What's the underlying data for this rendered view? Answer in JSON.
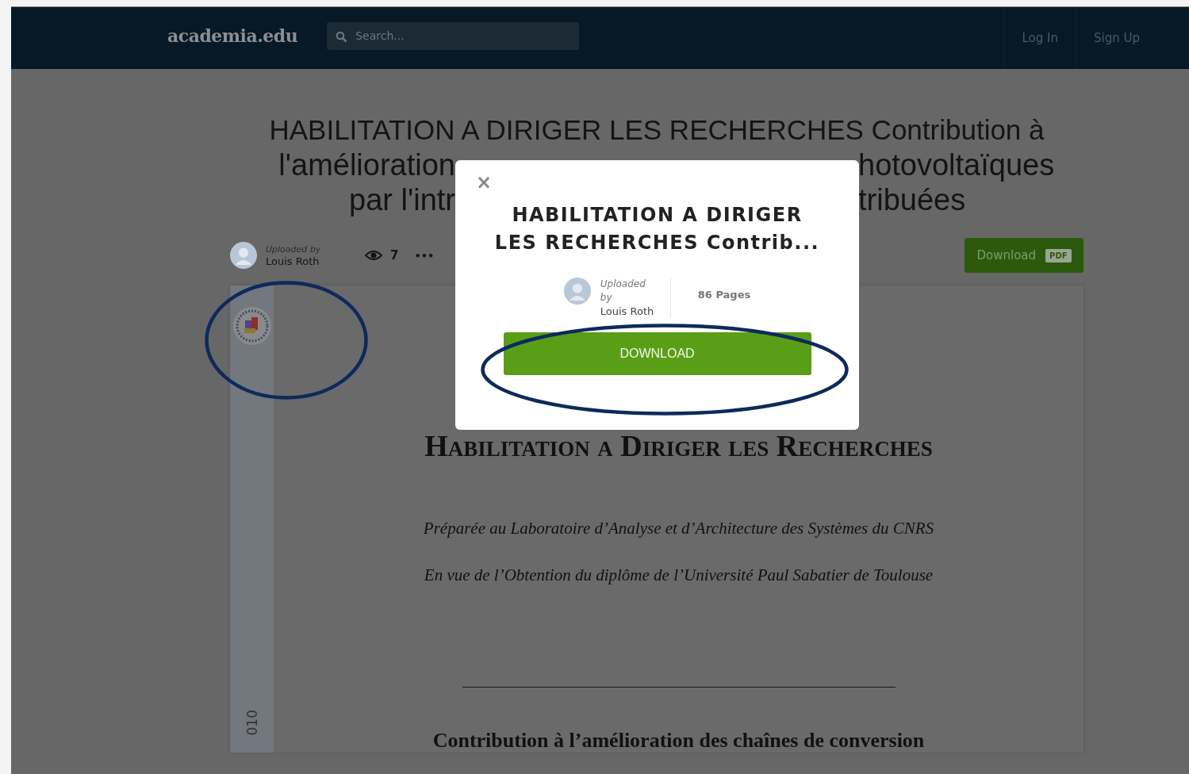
{
  "header": {
    "logo": "academia.edu",
    "search": {
      "placeholder": "Search..."
    },
    "nav": [
      {
        "label": "Log In"
      },
      {
        "label": "Sign Up"
      }
    ]
  },
  "document": {
    "title_lines": [
      {
        "left": "HABILITATION A DIRIGER LES RECHERCHES Contribution à"
      },
      {
        "left": "l'amélioration",
        "right": "hotovoltaïques"
      },
      {
        "left": "par l'intr",
        "right": "tribuées"
      }
    ],
    "uploader_label": "Uploaded by",
    "uploader": "Louis Roth",
    "views": "7",
    "more": "•••",
    "download_label": "Download",
    "download_badge": "PDF",
    "page": {
      "side_text": "010",
      "heading": "Habilitation a Diriger les Recherches",
      "lines": [
        "Préparée au Laboratoire d’Analyse et d’Architecture des Systèmes du CNRS",
        "En vue de l’Obtention du diplôme de l’Université Paul Sabatier de Toulouse"
      ],
      "subtitle": "Contribution à l’amélioration des chaînes de conversion"
    }
  },
  "modal": {
    "close": "×",
    "title_lines": [
      "HABILITATION A DIRIGER",
      "LES RECHERCHES Contrib..."
    ],
    "uploader_label": "Uploaded by",
    "uploader": "Louis Roth",
    "pages": "86 Pages",
    "button": "DOWNLOAD"
  },
  "highlights": [
    {
      "kind": "ellipse"
    },
    {
      "kind": "ellipse"
    }
  ]
}
